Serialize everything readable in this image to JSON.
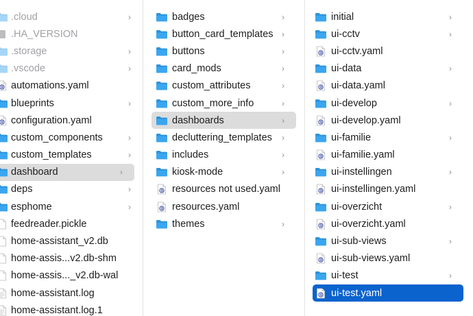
{
  "columns": [
    {
      "items": [
        {
          "label": ".cloud",
          "icon": "folder-icon",
          "chevron": true,
          "hidden": true
        },
        {
          "label": ".HA_VERSION",
          "icon": "file-icon",
          "chevron": false,
          "hidden": true
        },
        {
          "label": ".storage",
          "icon": "folder-icon",
          "chevron": true,
          "hidden": true
        },
        {
          "label": ".vscode",
          "icon": "folder-icon",
          "chevron": true,
          "hidden": true
        },
        {
          "label": "automations.yaml",
          "icon": "yaml-file-icon",
          "chevron": false
        },
        {
          "label": "blueprints",
          "icon": "folder-icon",
          "chevron": true
        },
        {
          "label": "configuration.yaml",
          "icon": "yaml-file-icon",
          "chevron": false
        },
        {
          "label": "custom_components",
          "icon": "folder-icon",
          "chevron": true
        },
        {
          "label": "custom_templates",
          "icon": "folder-icon",
          "chevron": true
        },
        {
          "label": "dashboard",
          "icon": "folder-icon",
          "chevron": true,
          "selected": "gray"
        },
        {
          "label": "deps",
          "icon": "folder-icon",
          "chevron": true
        },
        {
          "label": "esphome",
          "icon": "folder-icon",
          "chevron": true
        },
        {
          "label": "feedreader.pickle",
          "icon": "document-icon",
          "chevron": false
        },
        {
          "label": "home-assistant_v2.db",
          "icon": "document-icon",
          "chevron": false
        },
        {
          "label": "home-assis...v2.db-shm",
          "icon": "document-icon",
          "chevron": false
        },
        {
          "label": "home-assis..._v2.db-wal",
          "icon": "document-icon",
          "chevron": false
        },
        {
          "label": "home-assistant.log",
          "icon": "text-file-icon",
          "chevron": false
        },
        {
          "label": "home-assistant.log.1",
          "icon": "text-file-icon",
          "chevron": false
        }
      ]
    },
    {
      "items": [
        {
          "label": "badges",
          "icon": "folder-icon",
          "chevron": true
        },
        {
          "label": "button_card_templates",
          "icon": "folder-icon",
          "chevron": true
        },
        {
          "label": "buttons",
          "icon": "folder-icon",
          "chevron": true
        },
        {
          "label": "card_mods",
          "icon": "folder-icon",
          "chevron": true
        },
        {
          "label": "custom_attributes",
          "icon": "folder-icon",
          "chevron": true
        },
        {
          "label": "custom_more_info",
          "icon": "folder-icon",
          "chevron": true
        },
        {
          "label": "dashboards",
          "icon": "folder-icon",
          "chevron": true,
          "selected": "gray"
        },
        {
          "label": "decluttering_templates",
          "icon": "folder-icon",
          "chevron": true
        },
        {
          "label": "includes",
          "icon": "folder-icon",
          "chevron": true
        },
        {
          "label": "kiosk-mode",
          "icon": "folder-icon",
          "chevron": true
        },
        {
          "label": "resources not used.yaml",
          "icon": "yaml-file-icon",
          "chevron": false
        },
        {
          "label": "resources.yaml",
          "icon": "yaml-file-icon",
          "chevron": false
        },
        {
          "label": "themes",
          "icon": "folder-icon",
          "chevron": true
        }
      ]
    },
    {
      "items": [
        {
          "label": "initial",
          "icon": "folder-icon",
          "chevron": true
        },
        {
          "label": "ui-cctv",
          "icon": "folder-icon",
          "chevron": true
        },
        {
          "label": "ui-cctv.yaml",
          "icon": "yaml-file-icon",
          "chevron": false
        },
        {
          "label": "ui-data",
          "icon": "folder-icon",
          "chevron": true
        },
        {
          "label": "ui-data.yaml",
          "icon": "yaml-file-icon",
          "chevron": false
        },
        {
          "label": "ui-develop",
          "icon": "folder-icon",
          "chevron": true
        },
        {
          "label": "ui-develop.yaml",
          "icon": "yaml-file-icon",
          "chevron": false
        },
        {
          "label": "ui-familie",
          "icon": "folder-icon",
          "chevron": true
        },
        {
          "label": "ui-familie.yaml",
          "icon": "yaml-file-icon",
          "chevron": false
        },
        {
          "label": "ui-instellingen",
          "icon": "folder-icon",
          "chevron": true
        },
        {
          "label": "ui-instellingen.yaml",
          "icon": "yaml-file-icon",
          "chevron": false
        },
        {
          "label": "ui-overzicht",
          "icon": "folder-icon",
          "chevron": true
        },
        {
          "label": "ui-overzicht.yaml",
          "icon": "yaml-file-icon",
          "chevron": false
        },
        {
          "label": "ui-sub-views",
          "icon": "folder-icon",
          "chevron": true
        },
        {
          "label": "ui-sub-views.yaml",
          "icon": "yaml-file-icon",
          "chevron": false
        },
        {
          "label": "ui-test",
          "icon": "folder-icon",
          "chevron": true
        },
        {
          "label": "ui-test.yaml",
          "icon": "yaml-file-icon",
          "chevron": false,
          "selected": "blue"
        }
      ]
    }
  ],
  "chevron_glyph": "›",
  "colors": {
    "folder": "#3aa6ef",
    "folder_tab": "#2d93db",
    "selection_gray": "#dcdcdc",
    "selection_blue": "#0b63ce",
    "hidden_text": "#a1a1a6"
  }
}
